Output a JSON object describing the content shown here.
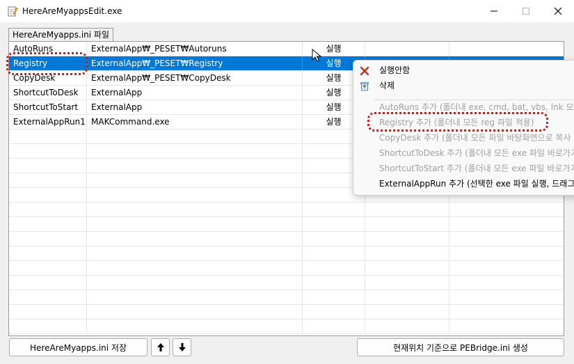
{
  "window": {
    "title": "HereAreMyappsEdit.exe"
  },
  "tab": {
    "label": "HereAreMyapps.ini 파일"
  },
  "table": {
    "rows": [
      {
        "name": "AutoRuns",
        "path": "ExternalApp₩_PESET₩Autoruns",
        "action": "실행",
        "selected": false
      },
      {
        "name": "Registry",
        "path": "ExternalApp₩_PESET₩Registry",
        "action": "실행",
        "selected": true
      },
      {
        "name": "CopyDesk",
        "path": "ExternalApp₩_PESET₩CopyDesk",
        "action": "실행",
        "selected": false
      },
      {
        "name": "ShortcutToDesk",
        "path": "ExternalApp",
        "action": "실행",
        "selected": false
      },
      {
        "name": "ShortcutToStart",
        "path": "ExternalApp",
        "action": "실행",
        "selected": false
      },
      {
        "name": "ExternalAppRun1",
        "path": "MAKCommand.exe",
        "action": "실행",
        "selected": false
      }
    ]
  },
  "context_menu": {
    "items": [
      {
        "label": "실행안함",
        "icon": "red-x-icon",
        "disabled": false
      },
      {
        "label": "삭제",
        "icon": "recycle-bin-icon",
        "disabled": false
      },
      {
        "label": "AutoRuns 추가 (폴더내 exe, cmd, bat, vbs, lnk 모두",
        "disabled": true
      },
      {
        "label": "Registry 추가 (폴더내 모든 reg 파일 적용)",
        "disabled": true
      },
      {
        "label": "CopyDesk 추가 (폴더내 모든 파일 바탕화면으로 복사",
        "disabled": true
      },
      {
        "label": "ShortcutToDesk 추가 (폴더내 모든 exe 파일 바로가기",
        "disabled": true
      },
      {
        "label": "ShortcutToStart 추가 (폴더내 모든 exe 파일 바로가기",
        "disabled": true
      },
      {
        "label": "ExternalAppRun 추가 (선택한 exe 파일 실행, 드래그하",
        "disabled": false
      }
    ]
  },
  "buttons": {
    "save": "HereAreMyapps.ini 저장",
    "up": "🡅",
    "down": "🡇",
    "generate": "현재위치 기준으로 PEBridge.ini 생성"
  },
  "colors": {
    "selection": "#0078d7",
    "highlight": "#d01818"
  }
}
